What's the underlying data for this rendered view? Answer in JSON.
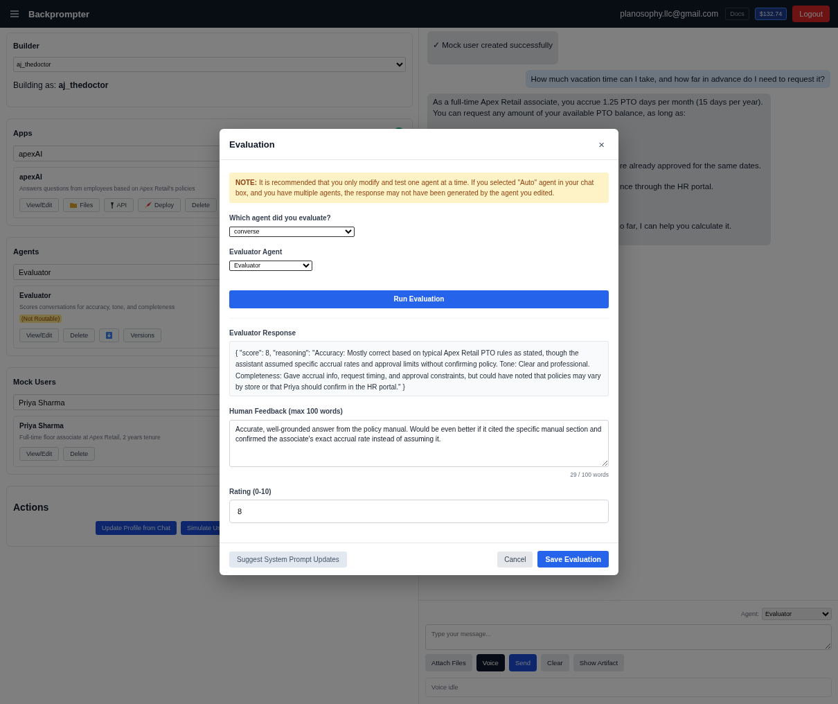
{
  "header": {
    "brand": "Backprompter",
    "email": "planosophy.llc@gmail.com",
    "docs": "Docs",
    "balance": "$132.74",
    "logout": "Logout"
  },
  "builder": {
    "title": "Builder",
    "select": "aj_thedoctor",
    "building_as": "Building as: **aj_thedoctor**"
  },
  "apps": {
    "title": "Apps",
    "select": "apexAI",
    "status_dot": true,
    "card": {
      "name": "apexAI",
      "description": "Answers questions from employees based on Apex Retail's policies",
      "buttons": [
        {
          "label": "View/Edit",
          "kind": "plain"
        },
        {
          "label": "Files",
          "kind": "files"
        },
        {
          "label": "API",
          "kind": "api"
        },
        {
          "label": "Deploy",
          "kind": "deploy"
        },
        {
          "label": "Delete",
          "kind": "plain"
        }
      ]
    }
  },
  "agents": {
    "title": "Agents",
    "select": "Evaluator",
    "card": {
      "name": "Evaluator",
      "description": "Scores conversations for accuracy, tone, and completeness",
      "badge": "(Not Routable)",
      "buttons": [
        {
          "label": "View/Edit",
          "kind": "plain"
        },
        {
          "label": "Delete",
          "kind": "plain"
        },
        {
          "kind": "download"
        },
        {
          "label": "Versions",
          "kind": "plain"
        }
      ]
    }
  },
  "mock_users": {
    "title": "Mock Users",
    "select": "Priya Sharma",
    "card": {
      "name": "Priya Sharma",
      "description": "Full-time floor associate at Apex Retail, 2 years tenure",
      "buttons": [
        {
          "label": "View/Edit",
          "kind": "plain"
        },
        {
          "label": "Delete",
          "kind": "plain"
        }
      ]
    }
  },
  "actions": {
    "title": "Actions",
    "buttons": [
      "Update Profile from Chat",
      "Simulate Us"
    ]
  },
  "chat": {
    "messages": [
      {
        "kind": "system",
        "lines": [
          "✓ Mock user created successfully"
        ]
      },
      {
        "kind": "user",
        "lines": [
          "How much vacation time can I take, and how far in advance do I need to request it?"
        ]
      },
      {
        "kind": "assistant",
        "lines": [
          "As a full-time Apex Retail associate, you accrue 1.25 PTO days per month (15 days per year).",
          "You can request any amount of your available PTO balance, as long as:",
          "re already approved for the same dates.",
          "nce through the HR portal.",
          "o far, I can help you calculate it."
        ]
      }
    ],
    "agent_label": "Agent:",
    "agent_select": "Evaluator",
    "placeholder": "Type your message...",
    "buttons": [
      {
        "label": "Attach Files",
        "kind": "plain"
      },
      {
        "label": "Voice",
        "kind": "dark"
      },
      {
        "label": "Send",
        "kind": "primary"
      },
      {
        "label": "Clear",
        "kind": "plain"
      },
      {
        "label": "Show Artifact",
        "kind": "plain"
      }
    ],
    "voice_status": "Voice idle"
  },
  "modal": {
    "title": "Evaluation",
    "close": "×",
    "note": "**NOTE:** It is recommended that you only modify and test one agent at a time. If you selected \"Auto\" agent in your chat box, and you have multiple agents, the response may not have been generated by the agent you edited.",
    "agent_label": "Which agent did you evaluate?",
    "agent_select": "converse",
    "evaluator_label": "Evaluator Agent",
    "evaluator_select": "Evaluator",
    "run_button": "Run Evaluation",
    "response_label": "Evaluator Response",
    "response": "{ \"score\": 8, \"reasoning\": \"Accuracy: Mostly correct based on typical Apex Retail PTO rules as stated, though the assistant assumed specific accrual rates and approval limits without confirming policy. Tone: Clear and professional. Completeness: Gave accrual info, request timing, and approval constraints, but could have noted that policies may vary by store or that Priya should confirm in the HR portal.\" }",
    "feedback_label": "Human Feedback (max 100 words)",
    "feedback": "Accurate, well-grounded answer from the policy manual. Would be even better if it cited the specific manual section and confirmed the associate's exact accrual rate instead of assuming it.",
    "word_count": "29 / 100 words",
    "rating_label": "Rating (0-10)",
    "rating": "8",
    "suggest_button": "Suggest System Prompt Updates",
    "cancel_button": "Cancel",
    "save_button": "Save Evaluation"
  }
}
